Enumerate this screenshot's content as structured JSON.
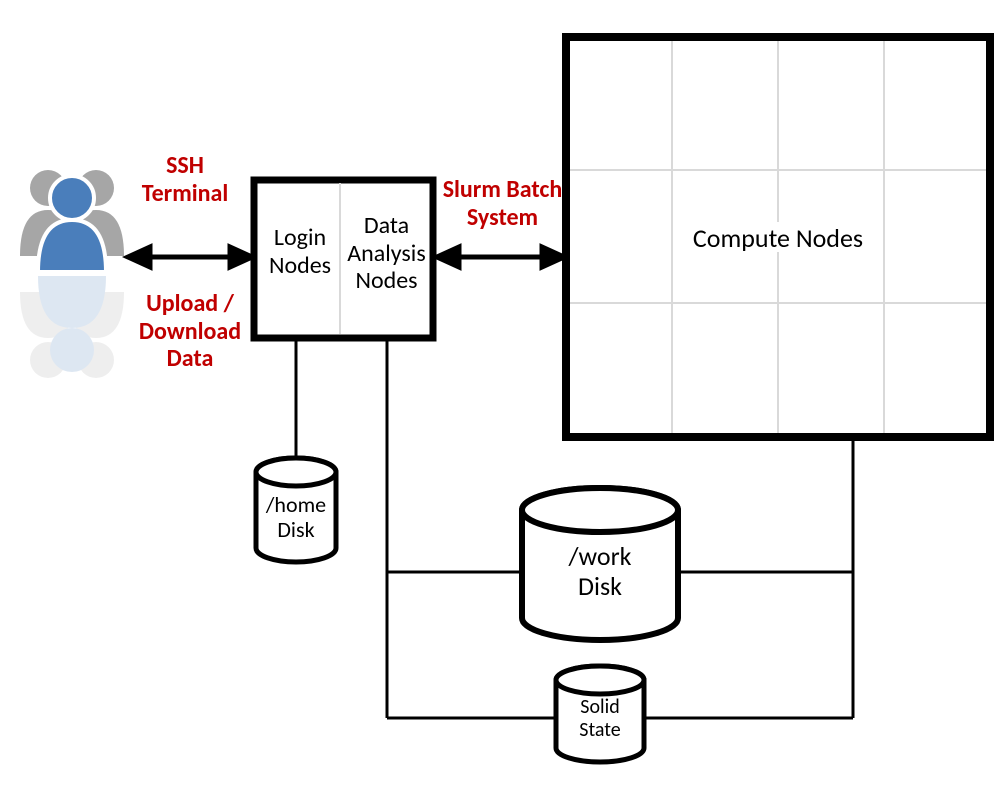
{
  "labels": {
    "ssh": "SSH\nTerminal",
    "upload": "Upload /\nDownload\nData",
    "login": "Login\nNodes",
    "analysis": "Data\nAnalysis\nNodes",
    "slurm": "Slurm Batch\nSystem",
    "compute": "Compute Nodes",
    "home": "/home\nDisk",
    "work": "/work\nDisk",
    "solid": "Solid\nState"
  },
  "colors": {
    "red_text": "#c00000",
    "user_blue": "#4a7ebb",
    "user_grey": "#a6a6a6",
    "black": "#000000",
    "grid": "#d9d9d9",
    "white": "#ffffff"
  }
}
